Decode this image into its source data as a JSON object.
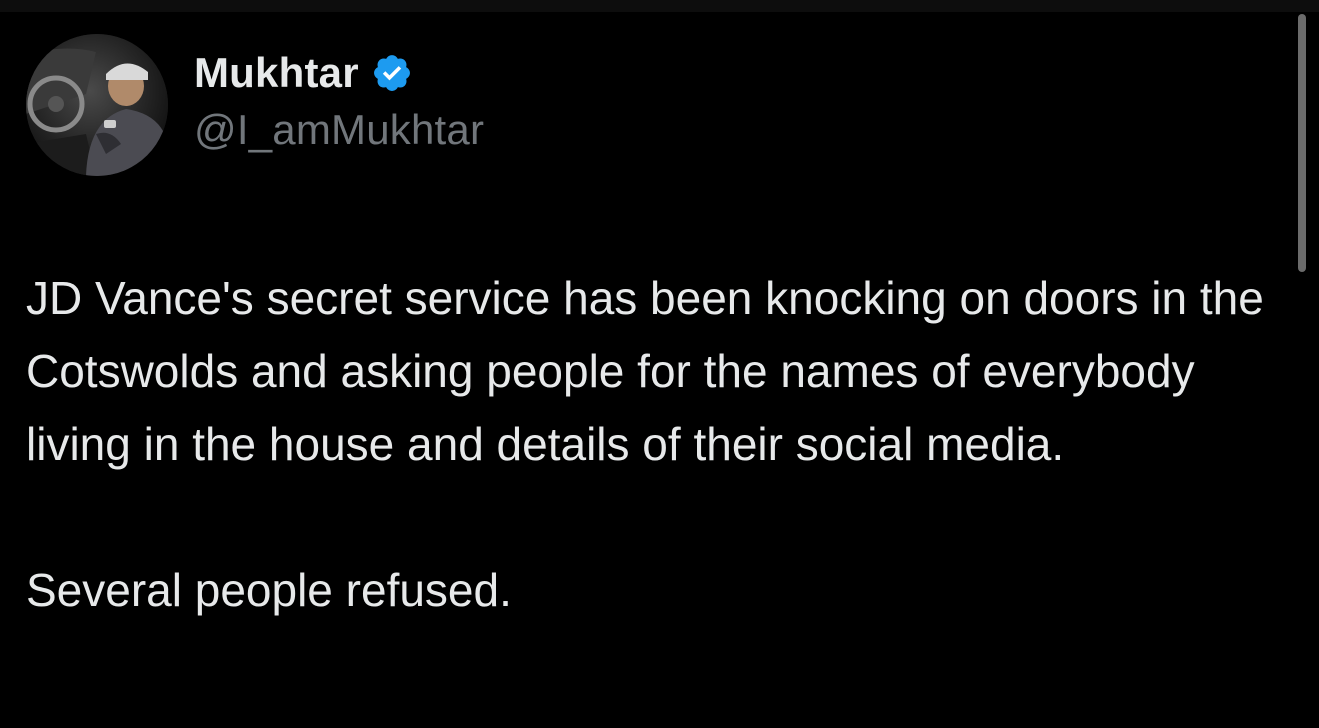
{
  "author": {
    "display_name": "Mukhtar",
    "handle": "@I_amMukhtar",
    "verified": true,
    "verified_icon": "verified-badge-icon"
  },
  "tweet": {
    "paragraphs": [
      "JD Vance's secret service has been knocking on doors in the Cotswolds and asking people for the names of everybody living in the house and details of their social media.",
      "Several people refused."
    ]
  },
  "colors": {
    "background": "#000000",
    "text": "#e7e9ea",
    "secondary_text": "#71767b",
    "verified_blue": "#1d9bf0",
    "scrollbar": "#6b6b6b"
  }
}
